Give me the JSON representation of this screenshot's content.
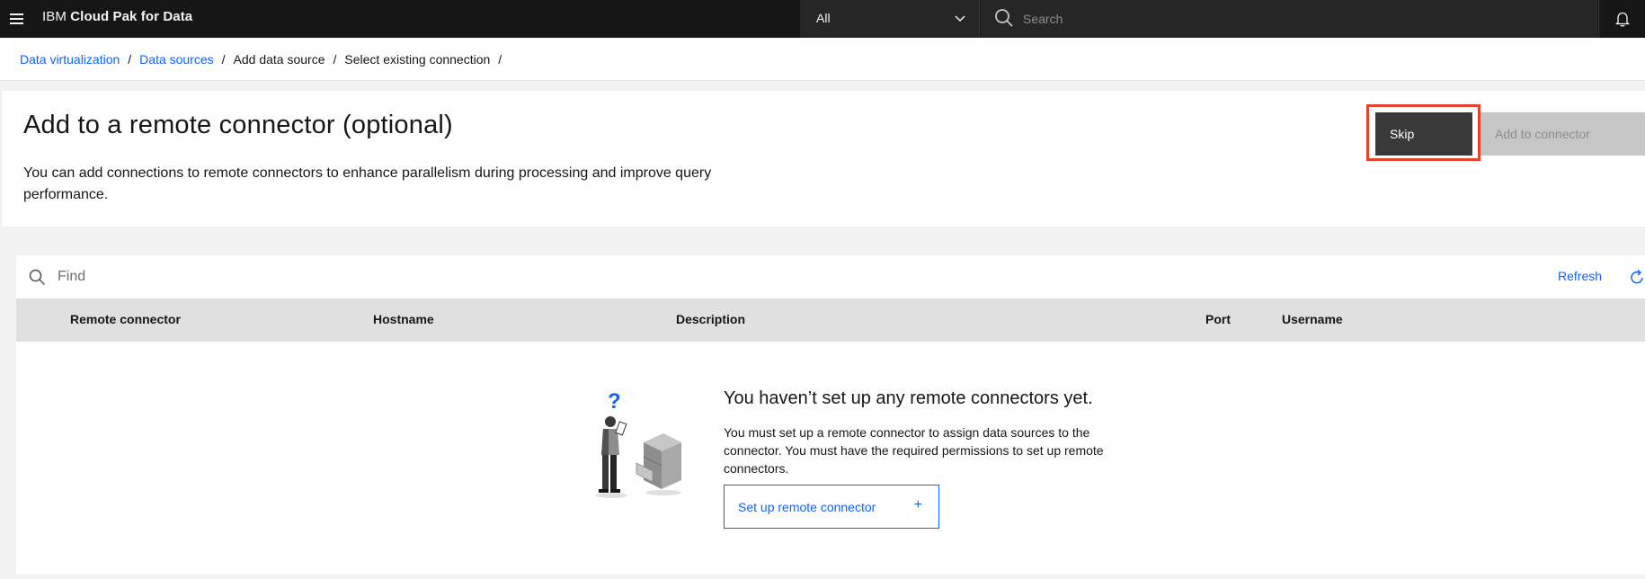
{
  "topbar": {
    "brand_prefix": "IBM",
    "brand_product": "Cloud Pak for Data",
    "scope_value": "All",
    "search_placeholder": "Search"
  },
  "breadcrumb": [
    {
      "label": "Data virtualization",
      "link": true
    },
    {
      "label": "Data sources",
      "link": true
    },
    {
      "label": "Add data source",
      "link": false
    },
    {
      "label": "Select existing connection",
      "link": false
    }
  ],
  "header": {
    "title": "Add to a remote connector (optional)",
    "description": "You can add connections to remote connectors to enhance parallelism during processing and improve query performance.",
    "skip_label": "Skip",
    "add_label": "Add to connector"
  },
  "table": {
    "find_placeholder": "Find",
    "refresh_label": "Refresh",
    "columns": [
      "Remote connector",
      "Hostname",
      "Description",
      "Port",
      "Username"
    ]
  },
  "empty_state": {
    "question_mark": "?",
    "title": "You haven’t set up any remote connectors yet.",
    "body": "You must set up a remote connector to assign data sources to the connector. You must have the required permissions to set up remote connectors.",
    "button_label": "Set up remote connector",
    "button_icon": "+"
  },
  "colors": {
    "accent": "#0f62fe",
    "highlight": "#e5432a",
    "topbar": "#161616"
  }
}
